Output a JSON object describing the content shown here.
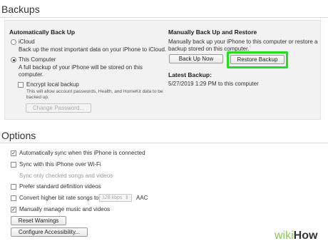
{
  "backups": {
    "title": "Backups",
    "auto": {
      "title": "Automatically Back Up",
      "icloud_label": "iCloud",
      "icloud_desc": "Back up the most important data on your iPhone to iCloud.",
      "computer_label": "This Computer",
      "computer_desc_1": "A full backup of your iPhone will be stored on this",
      "computer_desc_2": "computer.",
      "encrypt_label": "Encrypt local backup",
      "encrypt_desc_1": "This will allow account passwords, Health, and HomeKit data to be",
      "encrypt_desc_2": "backed up.",
      "change_password": "Change Password..."
    },
    "manual": {
      "title": "Manually Back Up and Restore",
      "desc_1": "Manually back up your iPhone to this computer or restore a",
      "desc_2": "backup stored on this computer.",
      "back_up_now": "Back Up Now",
      "restore_backup": "Restore Backup",
      "latest_title": "Latest Backup:",
      "latest_value": "5/27/2019 1:29 PM to this computer"
    }
  },
  "options": {
    "title": "Options",
    "auto_sync": "Automatically sync when this iPhone is connected",
    "wifi_sync": "Sync with this iPhone over Wi-Fi",
    "checked_only": "Sync only checked songs and videos",
    "prefer_sd": "Prefer standard definition videos",
    "convert": "Convert higher bit rate songs to",
    "bitrate": "128 kbps",
    "format": "AAC",
    "manual_manage": "Manually manage music and videos",
    "reset_warnings": "Reset Warnings",
    "configure_accessibility": "Configure Accessibility..."
  },
  "watermark": {
    "wiki": "wiki",
    "how": "How"
  }
}
